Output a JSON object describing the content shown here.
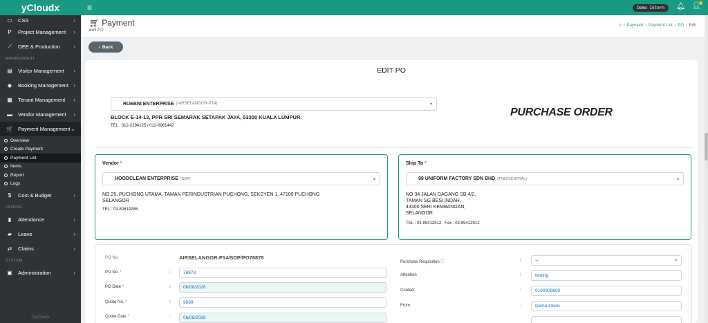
{
  "brand": "yCloudx",
  "sidebar": {
    "top_items": [
      {
        "label": "CSS",
        "icon": "css-icon"
      },
      {
        "label": "Project Management",
        "icon": "project-icon"
      },
      {
        "label": "OEE & Production",
        "icon": "chart-icon"
      }
    ],
    "section_management": "MANAGEMENT",
    "management_items": [
      {
        "label": "Visitor Management",
        "icon": "visitor-icon"
      },
      {
        "label": "Booking Management",
        "icon": "booking-icon"
      },
      {
        "label": "Tenant Management",
        "icon": "tenant-icon"
      },
      {
        "label": "Vendor Management",
        "icon": "vendor-icon"
      },
      {
        "label": "Payment Management",
        "icon": "cart-icon"
      }
    ],
    "payment_sub_items": [
      "Overview",
      "Create Payment",
      "Payment List",
      "Items",
      "Report",
      "Logs"
    ],
    "cost_item": {
      "label": "Cost & Budget",
      "icon": "dollar-icon"
    },
    "section_people": "PEOPLE",
    "people_items": [
      {
        "label": "Attendance",
        "icon": "attendance-icon"
      },
      {
        "label": "Leave",
        "icon": "leave-icon"
      },
      {
        "label": "Claims",
        "icon": "claims-icon"
      }
    ],
    "section_system": "SYSTEM",
    "system_items": [
      {
        "label": "Administration",
        "icon": "admin-icon"
      }
    ],
    "footer": "©yCloudx"
  },
  "topbar": {
    "user": "Demo Intern"
  },
  "page": {
    "title": "Payment",
    "subtitle": "Edit PO",
    "breadcrumb": [
      "Payment",
      "Payment List",
      "PO"
    ],
    "breadcrumb_current": "Edit",
    "back_label": "Back"
  },
  "card": {
    "title": "EDIT PO",
    "po_heading": "PURCHASE ORDER",
    "supplier": {
      "name": "RUEBNI ENTERPRISE",
      "code": "(AIRSELANGOR-P14)",
      "address": "BLOCK E-14-13, PPR SRI SEMARAK SETAPAK JAYA, 53300 KUALA LUMPUR.",
      "tel": "TEL : 012-2294125 / 012-6961442"
    },
    "vendor": {
      "label": "Vendor",
      "name": "HOODCLEAN ENTERPRISE",
      "code": "(SDP)",
      "address_line1": "NO.25, PUCHONG UTAMA, TAMAN PERINDUSTRIAN PUCHONG, SEKSYEN 1, 47100 PUCHONG",
      "address_line2": "SELANGOR",
      "tel": "TEL : 03-80614286"
    },
    "ship_to": {
      "label": "Ship To",
      "name": "99 UNIFORM FACTORY SDN BHD",
      "code": "(TNB2SENTRAL)",
      "address_line1": "NO 34 JALAN DAGANG SB 4/2,",
      "address_line2": "TAMAN SG BESI INDAH,",
      "address_line3": "43300 SERI KEMBANGAN,",
      "address_line4": "SELANGOR.",
      "tel": "TEL : 03-89412912",
      "fax": "Fax : 03-89412912"
    },
    "details": {
      "po_no_label": "PO No.",
      "po_number": "AIRSELANGOR-P14/SDP/PO76878",
      "po_no_field_label": "PO No.",
      "po_no_value": "76878",
      "po_date_label": "PO Date",
      "po_date_value": "06/08/2026",
      "quote_no_label": "Quote No.",
      "quote_no_value": "9999",
      "quote_date_label": "Quote Date",
      "quote_date_value": "06/08/2026",
      "pr_label": "Purchase Requisition",
      "pr_value": "--",
      "attention_label": "Attention",
      "attention_value": "testing",
      "contact_label": "Contact",
      "contact_value": "0190908800",
      "from_label": "From",
      "from_value": "Demo Intern"
    }
  }
}
